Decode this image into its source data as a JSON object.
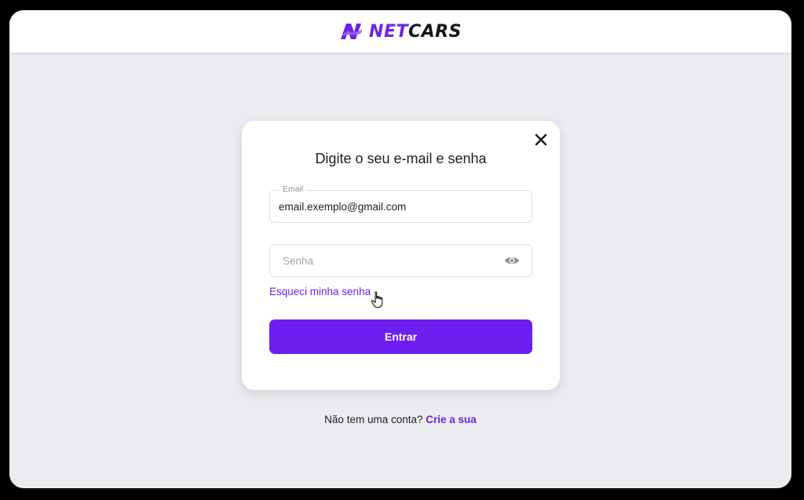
{
  "brand": {
    "name_part1": "NET",
    "name_part2": "CARS",
    "color_primary": "#6d22ec",
    "color_dark": "#16161d"
  },
  "modal": {
    "title": "Digite o seu e-mail e senha",
    "close_icon": "close-icon",
    "email": {
      "label": "Email",
      "value": "email.exemplo@gmail.com"
    },
    "password": {
      "placeholder": "Senha",
      "icon": "eye-icon"
    },
    "forgot_link": "Esqueci minha senha",
    "submit_label": "Entrar"
  },
  "signup": {
    "prompt": "Não tem uma conta?",
    "link": "Crie a sua"
  },
  "colors": {
    "accent": "#6d1ff0",
    "background": "#ebecf0",
    "card": "#ffffff"
  }
}
